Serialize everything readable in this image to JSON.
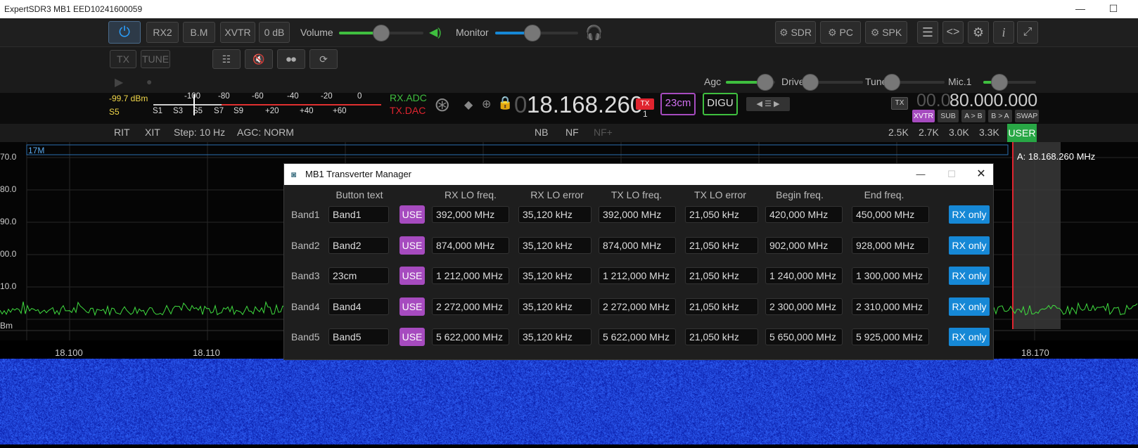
{
  "window": {
    "title": "ExpertSDR3 MB1 EED10241600059"
  },
  "toolbar": {
    "rx2": "RX2",
    "bm": "B.M",
    "xvtr": "XVTR",
    "att": "0 dB",
    "volume": "Volume",
    "monitor": "Monitor",
    "sdr": "SDR",
    "pc": "PC",
    "spk": "SPK",
    "volume_level": 0.5,
    "monitor_level": 0.45
  },
  "toolbar2": {
    "tx": "TX",
    "tune": "TUNE"
  },
  "levels": {
    "agc": "Agc",
    "drive": "Drive",
    "tune": "Tune",
    "mic": "Mic.1",
    "agc_level": 0.8,
    "drive_level": 0.0,
    "tune_level": 0.0,
    "mic_level": 0.3
  },
  "meter": {
    "dbm": "-99.7 dBm",
    "s": "S5",
    "top_scale": [
      "-100",
      "-80",
      "-60",
      "-40",
      "-20",
      "0"
    ],
    "bottom_scale": [
      "S1",
      "S3",
      "S5",
      "S7",
      "S9",
      "+20",
      "+40",
      "+60"
    ],
    "rxadc": "RX.ADC",
    "txdac": "TX.DAC"
  },
  "vfo": {
    "lead": "0",
    "freq": "18.168.260",
    "tx": "TX",
    "tx_num": "1",
    "band": "23cm",
    "mode": "DIGU",
    "tx_small": "TX",
    "vfob_dim": "00.0",
    "vfob": "80.000.000"
  },
  "subbtns": {
    "xvtr": "XVTR",
    "sub": "SUB",
    "atob": "A > B",
    "btoa": "B > A",
    "swap": "SWAP"
  },
  "row5": {
    "rit": "RIT",
    "xit": "XIT",
    "step": "Step: 10 Hz",
    "agc": "AGC: NORM",
    "nb": "NB",
    "nf": "NF",
    "nfplus": "NF+",
    "f1": "2.5K",
    "f2": "2.7K",
    "f3": "3.0K",
    "f4": "3.3K",
    "user": "USER"
  },
  "spectrum": {
    "band_label": "17M",
    "marker": "A: 18.168.260 MHz",
    "db": [
      "70.0",
      "80.0",
      "90.0",
      "00.0",
      "10.0",
      "Bm"
    ],
    "freqs": [
      "18.100",
      "18.110",
      "18.170"
    ]
  },
  "dialog": {
    "title": "MB1 Transverter Manager",
    "headers": [
      "Button text",
      "RX LO freq.",
      "RX LO error",
      "TX LO freq.",
      "TX LO error",
      "Begin freq.",
      "End freq."
    ],
    "use_label": "USE",
    "rx_label": "RX only",
    "bands": [
      {
        "name": "Band1",
        "text": "Band1",
        "rxlo": "392,000 MHz",
        "rxerr": "35,120 kHz",
        "txlo": "392,000 MHz",
        "txerr": "21,050 kHz",
        "begin": "420,000 MHz",
        "end": "450,000 MHz"
      },
      {
        "name": "Band2",
        "text": "Band2",
        "rxlo": "874,000 MHz",
        "rxerr": "35,120 kHz",
        "txlo": "874,000 MHz",
        "txerr": "21,050 kHz",
        "begin": "902,000 MHz",
        "end": "928,000 MHz"
      },
      {
        "name": "Band3",
        "text": "23cm",
        "rxlo": "1 212,000 MHz",
        "rxerr": "35,120 kHz",
        "txlo": "1 212,000 MHz",
        "txerr": "21,050 kHz",
        "begin": "1 240,000 MHz",
        "end": "1 300,000 MHz"
      },
      {
        "name": "Band4",
        "text": "Band4",
        "rxlo": "2 272,000 MHz",
        "rxerr": "35,120 kHz",
        "txlo": "2 272,000 MHz",
        "txerr": "21,050 kHz",
        "begin": "2 300,000 MHz",
        "end": "2 310,000 MHz"
      },
      {
        "name": "Band5",
        "text": "Band5",
        "rxlo": "5 622,000 MHz",
        "rxerr": "35,120 kHz",
        "txlo": "5 622,000 MHz",
        "txerr": "21,050 kHz",
        "begin": "5 650,000 MHz",
        "end": "5 925,000 MHz"
      }
    ]
  },
  "colors": {
    "accent": "#1688d6",
    "use": "#a64bbf",
    "green": "#3fbf3f",
    "red": "#e0242f"
  }
}
